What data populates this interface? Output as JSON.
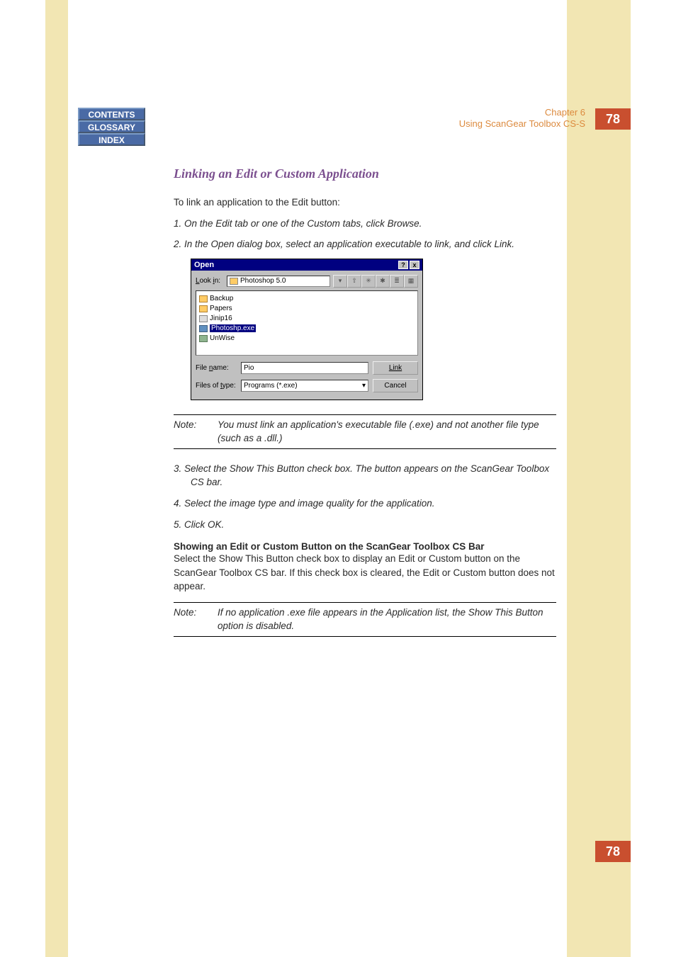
{
  "header": {
    "chapter": "Chapter 6",
    "chapter_title": "Using ScanGear Toolbox CS-S",
    "page_number": "78"
  },
  "nav": {
    "contents": "CONTENTS",
    "glossary": "GLOSSARY",
    "index": "INDEX"
  },
  "section_title": "Linking an Edit or Custom Application",
  "intro": "To link an application to the Edit button:",
  "steps": {
    "s1": "1.  On the Edit tab or one of the Custom tabs, click Browse.",
    "s2": "2.  In the Open dialog box, select an application executable to link, and click Link.",
    "s3": "3.  Select the Show This Button check box. The button appears on the ScanGear Toolbox CS bar.",
    "s4": "4.  Select the image type and image quality for the application.",
    "s5": "5.  Click OK."
  },
  "dialog": {
    "title": "Open",
    "help_btn": "?",
    "close_btn": "x",
    "lookin_label": "Look in:",
    "lookin_value": "Photoshop 5.0",
    "files": {
      "f1": "Backup",
      "f2": "Papers",
      "f3": "Jinip16",
      "f4": "Photoshp.exe",
      "f5": "UnWise"
    },
    "filename_label": "File name:",
    "filename_value": "Pio",
    "filetype_label": "Files of type:",
    "filetype_value": "Programs (*.exe)",
    "link_btn": "Link",
    "cancel_btn": "Cancel"
  },
  "note1": {
    "label": "Note:",
    "text": "You must link an application's executable file (.exe) and not another file type (such as a .dll.)"
  },
  "sub": {
    "heading": "Showing an Edit or Custom Button on the ScanGear Toolbox CS Bar",
    "text": "Select the Show This Button check box to display an Edit or Custom button on the ScanGear Toolbox CS bar. If this check box is cleared, the Edit or Custom button does not appear."
  },
  "note2": {
    "label": "Note:",
    "text": "If no application .exe file appears in the Application list, the Show This Button option is disabled."
  }
}
